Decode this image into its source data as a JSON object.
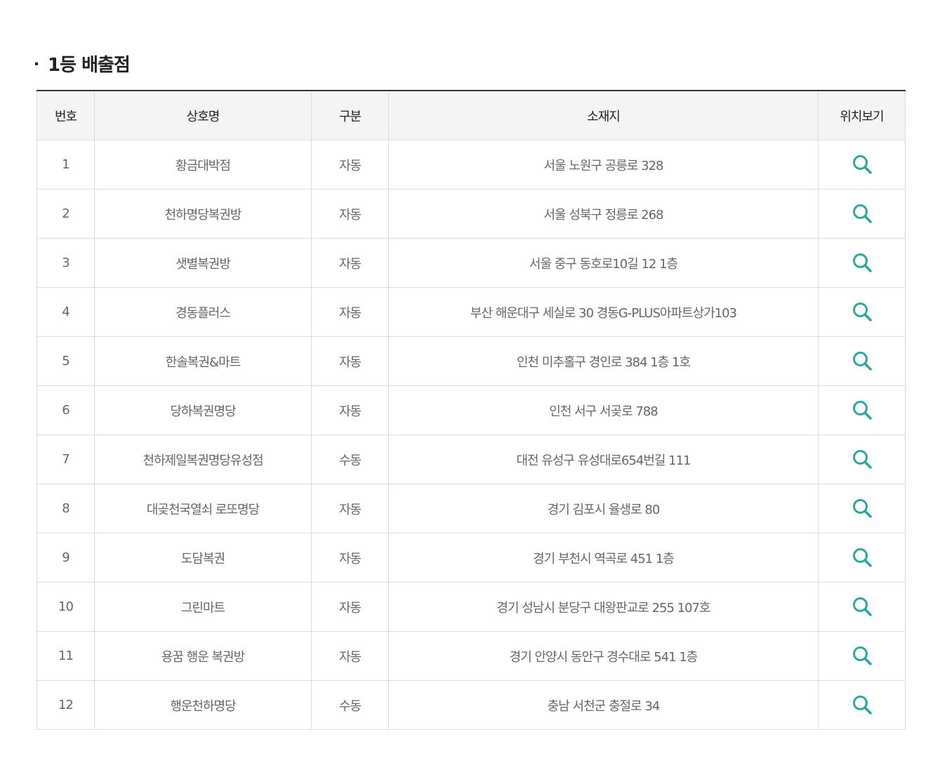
{
  "section": {
    "title": "1등 배출점"
  },
  "table": {
    "headers": {
      "no": "번호",
      "name": "상호명",
      "type": "구분",
      "address": "소재지",
      "location": "위치보기"
    },
    "rows": [
      {
        "no": "1",
        "name": "황금대박점",
        "type": "자동",
        "address": "서울 노원구 공릉로 328"
      },
      {
        "no": "2",
        "name": "천하명당복권방",
        "type": "자동",
        "address": "서울 성북구 정릉로 268"
      },
      {
        "no": "3",
        "name": "샛별복권방",
        "type": "자동",
        "address": "서울 중구 동호로10길 12 1층"
      },
      {
        "no": "4",
        "name": "경동플러스",
        "type": "자동",
        "address": "부산 해운대구 세실로 30 경동G-PLUS아파트상가103"
      },
      {
        "no": "5",
        "name": "한솔복권&마트",
        "type": "자동",
        "address": "인천 미추홀구 경인로 384 1층 1호"
      },
      {
        "no": "6",
        "name": "당하복권명당",
        "type": "자동",
        "address": "인천 서구 서곶로 788"
      },
      {
        "no": "7",
        "name": "천하제일복권명당유성점",
        "type": "수동",
        "address": "대전 유성구 유성대로654번길 111"
      },
      {
        "no": "8",
        "name": "대곶천국열쇠 로또명당",
        "type": "자동",
        "address": "경기 김포시 율생로 80"
      },
      {
        "no": "9",
        "name": "도담복권",
        "type": "자동",
        "address": "경기 부천시 역곡로 451 1층"
      },
      {
        "no": "10",
        "name": "그린마트",
        "type": "자동",
        "address": "경기 성남시 분당구 대왕판교로 255 107호"
      },
      {
        "no": "11",
        "name": "용꿈 행운 복권방",
        "type": "자동",
        "address": "경기 안양시 동안구 경수대로 541 1층"
      },
      {
        "no": "12",
        "name": "행운천하명당",
        "type": "수동",
        "address": "충남 서천군 충절로 34"
      }
    ]
  },
  "icons": {
    "search": "search-icon",
    "accent_color": "#2aa8a0"
  }
}
